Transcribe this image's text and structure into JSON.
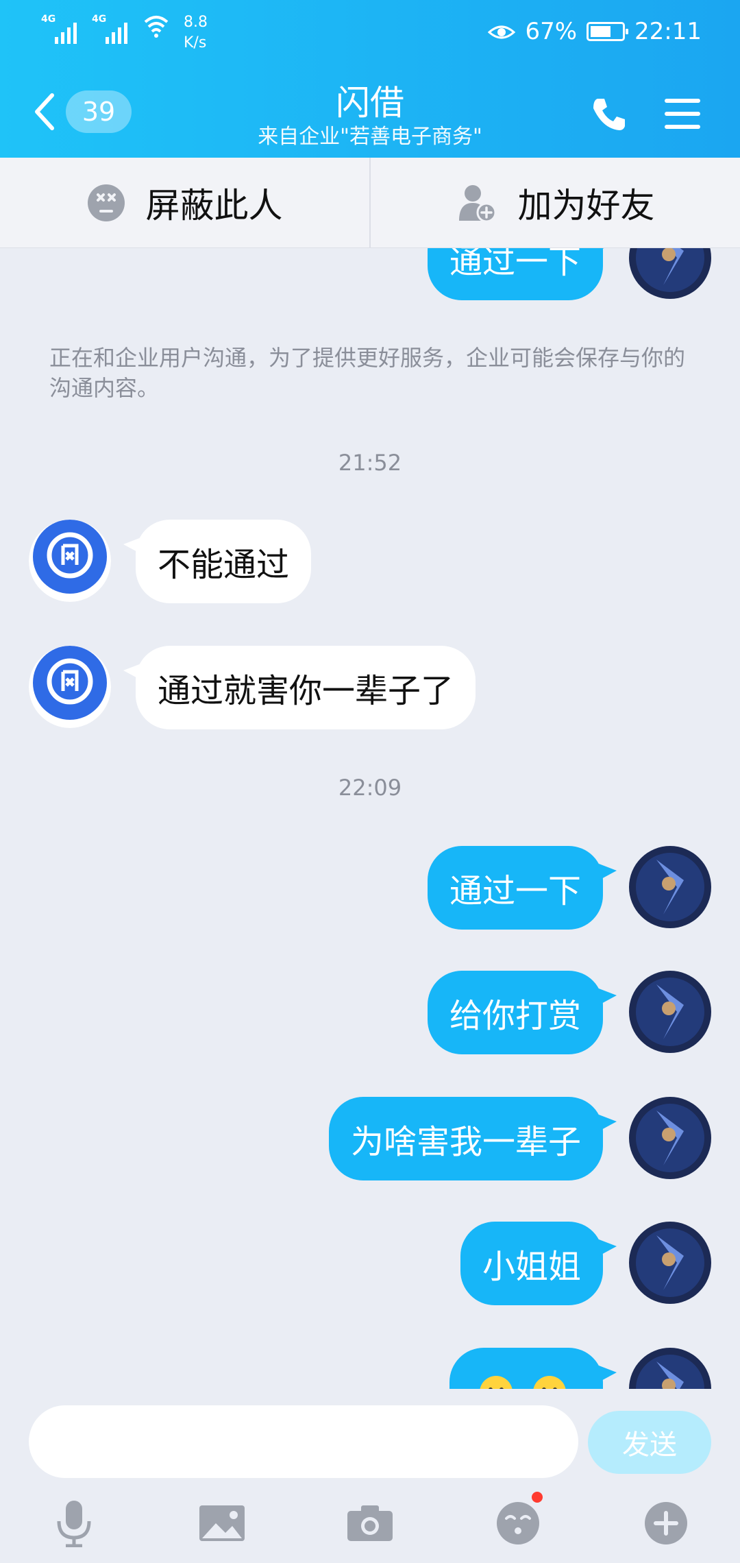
{
  "status_bar": {
    "signal1": "4G",
    "signal2": "4G",
    "speed_value": "8.8",
    "speed_unit": "K/s",
    "battery": "67%",
    "battery_level": 0.67,
    "time": "22:11"
  },
  "header": {
    "unread_count": "39",
    "title": "闪借",
    "subtitle": "来自企业\"若善电子商务\""
  },
  "actions": {
    "block": "屏蔽此人",
    "add_friend": "加为好友"
  },
  "chat": {
    "partial_top_message": "通过一下",
    "notice": "正在和企业用户沟通，为了提供更好服务，企业可能会保存与你的沟通内容。",
    "time1": "21:52",
    "in1": "不能通过",
    "in2": "通过就害你一辈子了",
    "time2": "22:09",
    "out1": "通过一下",
    "out2": "给你打赏",
    "out3": "为啥害我一辈子",
    "out4": "小姐姐",
    "logo_text": "闪借"
  },
  "input": {
    "placeholder": "",
    "send": "发送"
  },
  "colors": {
    "header_start": "#1fc3f8",
    "header_end": "#1ba6f1",
    "bubble_out": "#17b6f8",
    "background": "#eaedf4"
  }
}
